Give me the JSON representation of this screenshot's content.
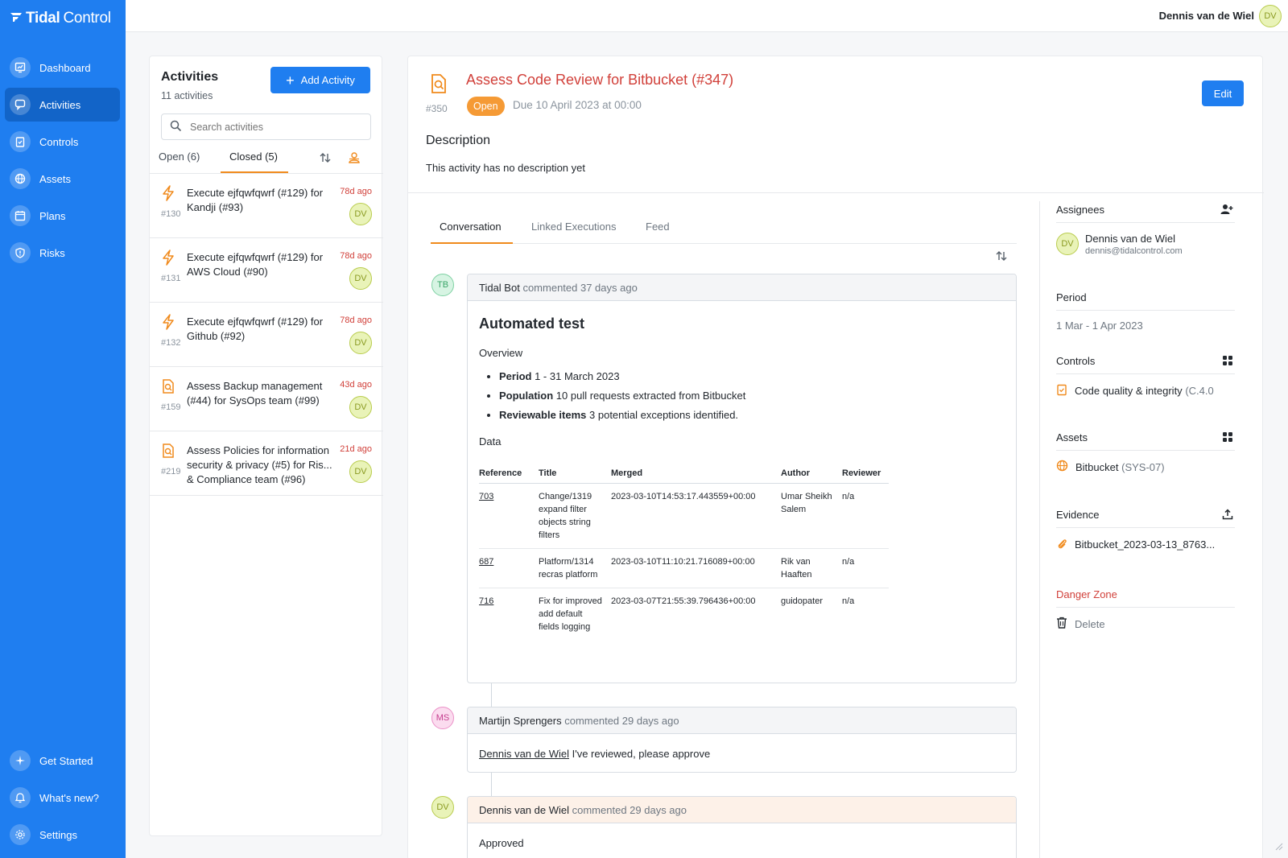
{
  "app": {
    "brand_bold": "Tidal",
    "brand_light": "Control"
  },
  "sidebar": {
    "items": [
      {
        "label": "Dashboard",
        "icon": "dashboard-icon"
      },
      {
        "label": "Activities",
        "icon": "activities-icon",
        "active": true
      },
      {
        "label": "Controls",
        "icon": "controls-icon"
      },
      {
        "label": "Assets",
        "icon": "globe-icon"
      },
      {
        "label": "Plans",
        "icon": "calendar-icon"
      },
      {
        "label": "Risks",
        "icon": "shield-icon"
      }
    ],
    "bottom_items": [
      {
        "label": "Get Started",
        "icon": "sparkle-icon"
      },
      {
        "label": "What's new?",
        "icon": "bell-icon"
      },
      {
        "label": "Settings",
        "icon": "gear-icon"
      }
    ]
  },
  "topbar": {
    "user_name": "Dennis van de Wiel",
    "user_initials": "DV"
  },
  "activities": {
    "title": "Activities",
    "count": "11 activities",
    "add_label": "Add Activity",
    "search_placeholder": "Search activities",
    "tabs": [
      {
        "label": "Open (6)"
      },
      {
        "label": "Closed (5)",
        "active": true
      }
    ],
    "items": [
      {
        "num": "#130",
        "text": "Execute ejfqwfqwrf (#129) for Kandji (#93)",
        "time": "78d ago",
        "initials": "DV",
        "icon": "lightning-icon"
      },
      {
        "num": "#131",
        "text": "Execute ejfqwfqwrf (#129) for AWS Cloud (#90)",
        "time": "78d ago",
        "initials": "DV",
        "icon": "lightning-icon"
      },
      {
        "num": "#132",
        "text": "Execute ejfqwfqwrf (#129) for Github (#92)",
        "time": "78d ago",
        "initials": "DV",
        "icon": "lightning-icon"
      },
      {
        "num": "#159",
        "text": "Assess Backup management (#44) for SysOps team (#99)",
        "time": "43d ago",
        "initials": "DV",
        "icon": "assess-icon"
      },
      {
        "num": "#219",
        "text": "Assess Policies for information security & privacy (#5) for Ris... & Compliance team (#96)",
        "time": "21d ago",
        "initials": "DV",
        "icon": "assess-icon"
      }
    ]
  },
  "detail": {
    "num": "#350",
    "title": "Assess Code Review for Bitbucket (#347)",
    "status": "Open",
    "due": "Due 10 April 2023 at 00:00",
    "edit_label": "Edit",
    "description_title": "Description",
    "description_text": "This activity has no description yet",
    "tabs": [
      {
        "label": "Conversation",
        "active": true
      },
      {
        "label": "Linked Executions"
      },
      {
        "label": "Feed"
      }
    ]
  },
  "comments": [
    {
      "initials": "TB",
      "author": "Tidal Bot",
      "meta": "commented 37 days ago",
      "heading": "Automated test",
      "overview_label": "Overview",
      "bullets": [
        {
          "key": "Period",
          "value": "1 - 31 March 2023"
        },
        {
          "key": "Population",
          "value": "10 pull requests extracted from Bitbucket"
        },
        {
          "key": "Reviewable items",
          "value": "3 potential exceptions identified."
        }
      ],
      "data_label": "Data",
      "table": {
        "headers": [
          "Reference",
          "Title",
          "Merged",
          "Author",
          "Reviewer"
        ],
        "rows": [
          [
            "703",
            "Change/1319 expand filter objects string filters",
            "2023-03-10T14:53:17.443559+00:00",
            "Umar Sheikh Salem",
            "n/a"
          ],
          [
            "687",
            "Platform/1314 recras platform",
            "2023-03-10T11:10:21.716089+00:00",
            "Rik van Haaften",
            "n/a"
          ],
          [
            "716",
            "Fix for improved add default fields logging",
            "2023-03-07T21:55:39.796436+00:00",
            "guidopater",
            "n/a"
          ]
        ]
      }
    },
    {
      "initials": "MS",
      "author": "Martijn Sprengers",
      "meta": "commented 29 days ago",
      "mention": "Dennis van de Wiel",
      "text": " I've reviewed, please approve"
    },
    {
      "initials": "DV",
      "author": "Dennis van de Wiel",
      "meta": "commented 29 days ago",
      "text": "Approved"
    }
  ],
  "side": {
    "assignees_title": "Assignees",
    "assignee_name": "Dennis van de Wiel",
    "assignee_email": "dennis@tidalcontrol.com",
    "assignee_initials": "DV",
    "period_title": "Period",
    "period_value": "1 Mar - 1 Apr 2023",
    "controls_title": "Controls",
    "control_name": "Code quality & integrity",
    "control_code": "(C.4.0",
    "assets_title": "Assets",
    "asset_name": "Bitbucket",
    "asset_code": "(SYS-07)",
    "evidence_title": "Evidence",
    "evidence_file": "Bitbucket_2023-03-13_8763...",
    "danger_title": "Danger Zone",
    "delete_label": "Delete"
  },
  "colors": {
    "brand": "#1f7ef0",
    "accent": "#f08a1c",
    "title_red": "#d1403a"
  }
}
